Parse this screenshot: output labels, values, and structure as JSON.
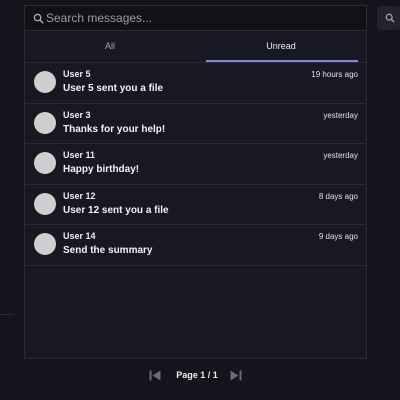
{
  "search": {
    "placeholder": "Search messages...",
    "value": ""
  },
  "tabs": [
    {
      "label": "All",
      "active": false
    },
    {
      "label": "Unread",
      "active": true
    }
  ],
  "messages": [
    {
      "sender": "User 5",
      "preview": "User 5 sent you a file",
      "time": "19 hours ago"
    },
    {
      "sender": "User 3",
      "preview": "Thanks for your help!",
      "time": "yesterday"
    },
    {
      "sender": "User 11",
      "preview": "Happy birthday!",
      "time": "yesterday"
    },
    {
      "sender": "User 12",
      "preview": "User 12 sent you a file",
      "time": "8 days ago"
    },
    {
      "sender": "User 14",
      "preview": "Send the summary",
      "time": "9 days ago"
    }
  ],
  "pager": {
    "label": "Page 1 / 1"
  },
  "colors": {
    "accent": "#8585d8",
    "background": "#14141c",
    "avatar": "#cfcfcf"
  },
  "icons": {
    "search": "search-icon",
    "prev": "skip-previous-icon",
    "next": "skip-next-icon"
  }
}
